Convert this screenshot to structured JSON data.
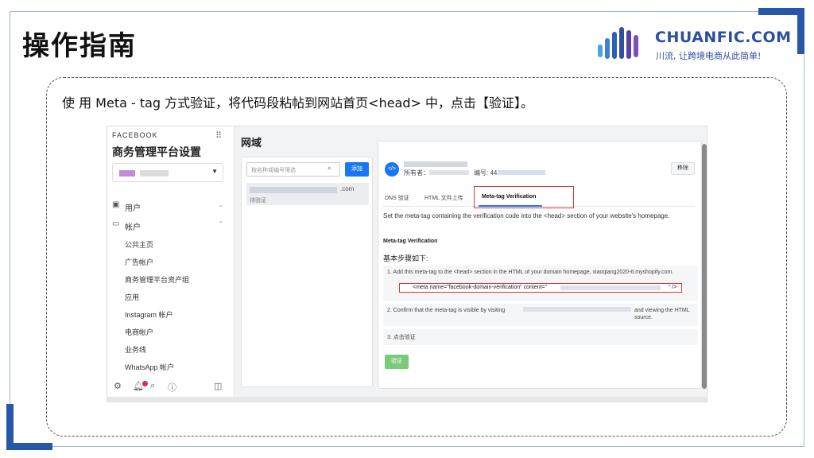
{
  "slide": {
    "title": "操作指南",
    "instruction": "使 用 Meta - tag 方式验证，将代码段粘帖到网站首页<head> 中，点击【验证】。"
  },
  "logo": {
    "name": "CHUANFIC.COM",
    "slogan": "川流, 让跨境电商从此简单!"
  },
  "colors": {
    "accent": "#2657a8",
    "facebook_blue": "#1877f2",
    "highlight_red": "#dd3333",
    "verify_green": "#7bc97a"
  },
  "screenshot": {
    "sidebar": {
      "brand": "FACEBOOK",
      "title": "商务管理平台设置",
      "nav": [
        {
          "label": "用户",
          "icon": "users-icon"
        },
        {
          "label": "帐户",
          "icon": "accounts-icon"
        }
      ],
      "sub_items": [
        "公共主页",
        "广告帐户",
        "商务管理平台资产组",
        "应用",
        "Instagram 帐户",
        "电商帐户",
        "业务线",
        "WhatsApp 帐户"
      ]
    },
    "page_heading": "网域",
    "list": {
      "filter_placeholder": "按名称或编号筛选",
      "add_label": "添加",
      "domain_suffix": ".com",
      "domain_status": "待验证"
    },
    "detail": {
      "owner_label": "所有者：",
      "id_label": "编号: 44",
      "remove_label": "移除",
      "tabs": [
        "DNS 验证",
        "HTML 文件上传",
        "Meta-tag Verification"
      ],
      "description": "Set the meta-tag containing the verification code into the <head> section of your website's homepage.",
      "section_title": "Meta-tag Verification",
      "steps_heading": "基本步骤如下:",
      "step1": "1. Add this meta-tag to the <head> section in the HTML of your domain homepage, xiaoqiang2020-6.myshopify.com.",
      "snippet": "<meta name=\"facebook-domain-verification\" content=\"",
      "snippet_end": "\" />",
      "step2": "2. Confirm that the meta-tag is visible by visiting",
      "step2_tail": "and viewing the HTML source.",
      "step3": "3. 点击验证",
      "verify_label": "验证"
    }
  }
}
